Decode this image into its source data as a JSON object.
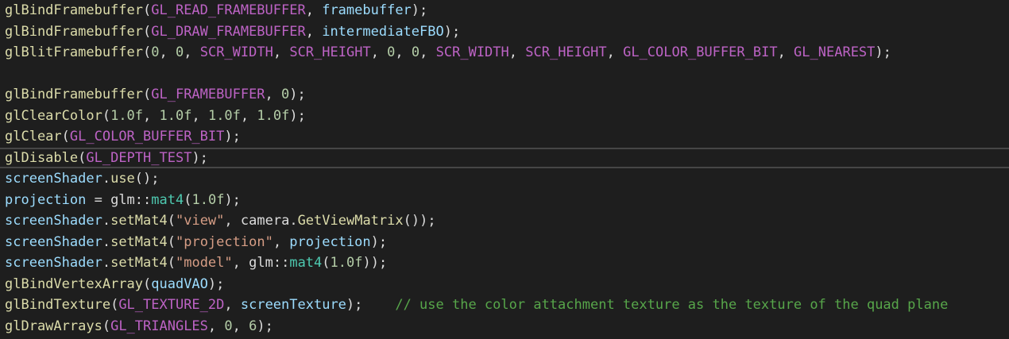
{
  "colors": {
    "background": "#1e1e1e",
    "function": "#dcdcaa",
    "plain": "#dcdcdc",
    "macro": "#bd63c5",
    "variable": "#9cdcfe",
    "number": "#b5cea8",
    "string": "#d69d85",
    "type": "#4ec9b0",
    "comment": "#57a64a",
    "current_line_border": "#464646"
  },
  "code": {
    "current_line_index": 7,
    "lines": [
      [
        {
          "t": "fn",
          "s": "glBindFramebuffer"
        },
        {
          "t": "plain",
          "s": "("
        },
        {
          "t": "macro",
          "s": "GL_READ_FRAMEBUFFER"
        },
        {
          "t": "plain",
          "s": ", "
        },
        {
          "t": "var",
          "s": "framebuffer"
        },
        {
          "t": "plain",
          "s": ");"
        }
      ],
      [
        {
          "t": "fn",
          "s": "glBindFramebuffer"
        },
        {
          "t": "plain",
          "s": "("
        },
        {
          "t": "macro",
          "s": "GL_DRAW_FRAMEBUFFER"
        },
        {
          "t": "plain",
          "s": ", "
        },
        {
          "t": "var",
          "s": "intermediateFBO"
        },
        {
          "t": "plain",
          "s": ");"
        }
      ],
      [
        {
          "t": "fn",
          "s": "glBlitFramebuffer"
        },
        {
          "t": "plain",
          "s": "("
        },
        {
          "t": "num",
          "s": "0"
        },
        {
          "t": "plain",
          "s": ", "
        },
        {
          "t": "num",
          "s": "0"
        },
        {
          "t": "plain",
          "s": ", "
        },
        {
          "t": "macro",
          "s": "SCR_WIDTH"
        },
        {
          "t": "plain",
          "s": ", "
        },
        {
          "t": "macro",
          "s": "SCR_HEIGHT"
        },
        {
          "t": "plain",
          "s": ", "
        },
        {
          "t": "num",
          "s": "0"
        },
        {
          "t": "plain",
          "s": ", "
        },
        {
          "t": "num",
          "s": "0"
        },
        {
          "t": "plain",
          "s": ", "
        },
        {
          "t": "macro",
          "s": "SCR_WIDTH"
        },
        {
          "t": "plain",
          "s": ", "
        },
        {
          "t": "macro",
          "s": "SCR_HEIGHT"
        },
        {
          "t": "plain",
          "s": ", "
        },
        {
          "t": "macro",
          "s": "GL_COLOR_BUFFER_BIT"
        },
        {
          "t": "plain",
          "s": ", "
        },
        {
          "t": "macro",
          "s": "GL_NEAREST"
        },
        {
          "t": "plain",
          "s": ");"
        }
      ],
      [],
      [
        {
          "t": "fn",
          "s": "glBindFramebuffer"
        },
        {
          "t": "plain",
          "s": "("
        },
        {
          "t": "macro",
          "s": "GL_FRAMEBUFFER"
        },
        {
          "t": "plain",
          "s": ", "
        },
        {
          "t": "num",
          "s": "0"
        },
        {
          "t": "plain",
          "s": ");"
        }
      ],
      [
        {
          "t": "fn",
          "s": "glClearColor"
        },
        {
          "t": "plain",
          "s": "("
        },
        {
          "t": "num",
          "s": "1.0f"
        },
        {
          "t": "plain",
          "s": ", "
        },
        {
          "t": "num",
          "s": "1.0f"
        },
        {
          "t": "plain",
          "s": ", "
        },
        {
          "t": "num",
          "s": "1.0f"
        },
        {
          "t": "plain",
          "s": ", "
        },
        {
          "t": "num",
          "s": "1.0f"
        },
        {
          "t": "plain",
          "s": ");"
        }
      ],
      [
        {
          "t": "fn",
          "s": "glClear"
        },
        {
          "t": "plain",
          "s": "("
        },
        {
          "t": "macro",
          "s": "GL_COLOR_BUFFER_BIT"
        },
        {
          "t": "plain",
          "s": ");"
        }
      ],
      [
        {
          "t": "fn",
          "s": "glDisable"
        },
        {
          "t": "plain",
          "s": "("
        },
        {
          "t": "macro",
          "s": "GL_DEPTH_TEST"
        },
        {
          "t": "plain",
          "s": ");"
        }
      ],
      [
        {
          "t": "var",
          "s": "screenShader"
        },
        {
          "t": "plain",
          "s": "."
        },
        {
          "t": "fn",
          "s": "use"
        },
        {
          "t": "plain",
          "s": "();"
        }
      ],
      [
        {
          "t": "var",
          "s": "projection"
        },
        {
          "t": "plain",
          "s": " = "
        },
        {
          "t": "ns",
          "s": "glm"
        },
        {
          "t": "plain",
          "s": "::"
        },
        {
          "t": "type",
          "s": "mat4"
        },
        {
          "t": "plain",
          "s": "("
        },
        {
          "t": "num",
          "s": "1.0f"
        },
        {
          "t": "plain",
          "s": ");"
        }
      ],
      [
        {
          "t": "var",
          "s": "screenShader"
        },
        {
          "t": "plain",
          "s": "."
        },
        {
          "t": "fn",
          "s": "setMat4"
        },
        {
          "t": "plain",
          "s": "("
        },
        {
          "t": "str",
          "s": "\"view\""
        },
        {
          "t": "plain",
          "s": ", "
        },
        {
          "t": "plain",
          "s": "camera"
        },
        {
          "t": "plain",
          "s": "."
        },
        {
          "t": "fn",
          "s": "GetViewMatrix"
        },
        {
          "t": "plain",
          "s": "());"
        }
      ],
      [
        {
          "t": "var",
          "s": "screenShader"
        },
        {
          "t": "plain",
          "s": "."
        },
        {
          "t": "fn",
          "s": "setMat4"
        },
        {
          "t": "plain",
          "s": "("
        },
        {
          "t": "str",
          "s": "\"projection\""
        },
        {
          "t": "plain",
          "s": ", "
        },
        {
          "t": "var",
          "s": "projection"
        },
        {
          "t": "plain",
          "s": ");"
        }
      ],
      [
        {
          "t": "var",
          "s": "screenShader"
        },
        {
          "t": "plain",
          "s": "."
        },
        {
          "t": "fn",
          "s": "setMat4"
        },
        {
          "t": "plain",
          "s": "("
        },
        {
          "t": "str",
          "s": "\"model\""
        },
        {
          "t": "plain",
          "s": ", "
        },
        {
          "t": "ns",
          "s": "glm"
        },
        {
          "t": "plain",
          "s": "::"
        },
        {
          "t": "type",
          "s": "mat4"
        },
        {
          "t": "plain",
          "s": "("
        },
        {
          "t": "num",
          "s": "1.0f"
        },
        {
          "t": "plain",
          "s": "));"
        }
      ],
      [
        {
          "t": "fn",
          "s": "glBindVertexArray"
        },
        {
          "t": "plain",
          "s": "("
        },
        {
          "t": "var",
          "s": "quadVAO"
        },
        {
          "t": "plain",
          "s": ");"
        }
      ],
      [
        {
          "t": "fn",
          "s": "glBindTexture"
        },
        {
          "t": "plain",
          "s": "("
        },
        {
          "t": "macro",
          "s": "GL_TEXTURE_2D"
        },
        {
          "t": "plain",
          "s": ", "
        },
        {
          "t": "var",
          "s": "screenTexture"
        },
        {
          "t": "plain",
          "s": ");    "
        },
        {
          "t": "comment",
          "s": "// use the color attachment texture as the texture of the quad plane"
        }
      ],
      [
        {
          "t": "fn",
          "s": "glDrawArrays"
        },
        {
          "t": "plain",
          "s": "("
        },
        {
          "t": "macro",
          "s": "GL_TRIANGLES"
        },
        {
          "t": "plain",
          "s": ", "
        },
        {
          "t": "num",
          "s": "0"
        },
        {
          "t": "plain",
          "s": ", "
        },
        {
          "t": "num",
          "s": "6"
        },
        {
          "t": "plain",
          "s": ");"
        }
      ]
    ]
  }
}
